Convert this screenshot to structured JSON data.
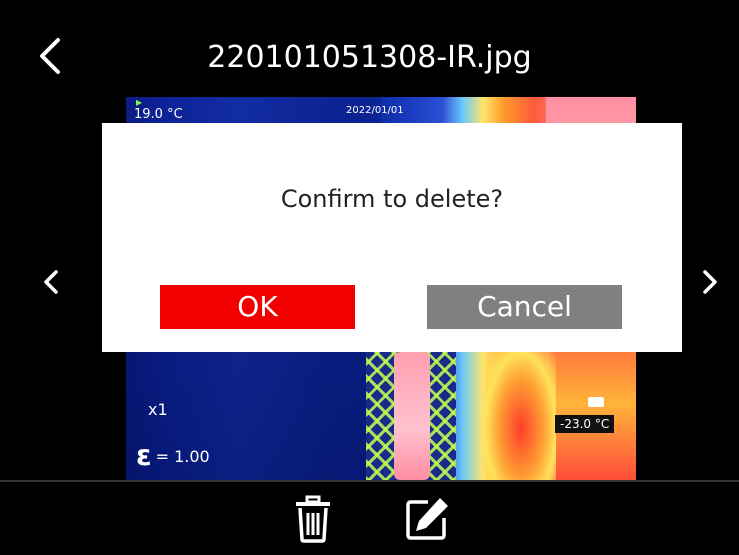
{
  "header": {
    "title": "220101051308-IR.jpg",
    "back_icon": "chevron-left-icon"
  },
  "image": {
    "min_temp": "19.0 °C",
    "datetime": "2022/01/01",
    "zoom": "x1",
    "emissivity_symbol": "ε",
    "emissivity_value": "= 1.00",
    "max_temp": "-23.0 °C"
  },
  "navigation": {
    "prev_icon": "chevron-left-icon",
    "next_icon": "chevron-right-icon"
  },
  "dialog": {
    "message": "Confirm to delete?",
    "ok_label": "OK",
    "cancel_label": "Cancel",
    "ok_color": "#f20000",
    "cancel_color": "#808080"
  },
  "toolbar": {
    "delete_icon": "trash-icon",
    "edit_icon": "edit-icon"
  }
}
